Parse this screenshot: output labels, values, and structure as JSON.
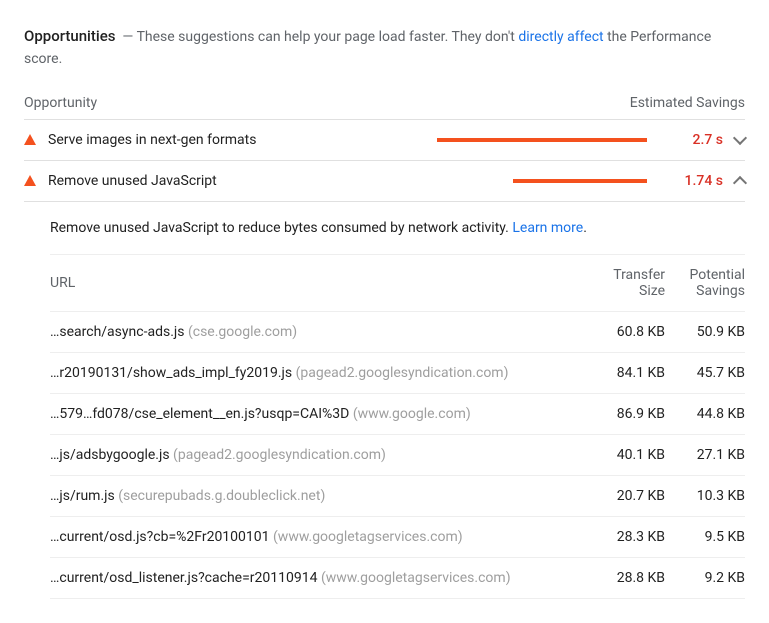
{
  "header": {
    "title": "Opportunities",
    "dash": "—",
    "desc_before": "These suggestions can help your page load faster. They don't ",
    "link": "directly affect",
    "desc_after": " the Performance score."
  },
  "columns": {
    "opportunity": "Opportunity",
    "savings": "Estimated Savings"
  },
  "rows": [
    {
      "title": "Serve images in next-gen formats",
      "bar_width": "100%",
      "savings": "2.7 s",
      "expanded": false
    },
    {
      "title": "Remove unused JavaScript",
      "bar_width": "64%",
      "savings": "1.74 s",
      "expanded": true
    }
  ],
  "detail": {
    "desc": "Remove unused JavaScript to reduce bytes consumed by network activity. ",
    "learn_more": "Learn more",
    "period": ".",
    "columns": {
      "url": "URL",
      "transfer": "Transfer Size",
      "potential": "Potential Savings"
    },
    "items": [
      {
        "path": "…search/async-ads.js",
        "domain": "(cse.google.com)",
        "transfer": "60.8 KB",
        "potential": "50.9 KB"
      },
      {
        "path": "…r20190131/show_ads_impl_fy2019.js",
        "domain": "(pagead2.googlesyndication.com)",
        "transfer": "84.1 KB",
        "potential": "45.7 KB"
      },
      {
        "path": "…579…fd078/cse_element__en.js?usqp=CAI%3D",
        "domain": "(www.google.com)",
        "transfer": "86.9 KB",
        "potential": "44.8 KB"
      },
      {
        "path": "…js/adsbygoogle.js",
        "domain": "(pagead2.googlesyndication.com)",
        "transfer": "40.1 KB",
        "potential": "27.1 KB"
      },
      {
        "path": "…js/rum.js",
        "domain": "(securepubads.g.doubleclick.net)",
        "transfer": "20.7 KB",
        "potential": "10.3 KB"
      },
      {
        "path": "…current/osd.js?cb=%2Fr20100101",
        "domain": "(www.googletagservices.com)",
        "transfer": "28.3 KB",
        "potential": "9.5 KB"
      },
      {
        "path": "…current/osd_listener.js?cache=r20110914",
        "domain": "(www.googletagservices.com)",
        "transfer": "28.8 KB",
        "potential": "9.2 KB"
      }
    ]
  }
}
